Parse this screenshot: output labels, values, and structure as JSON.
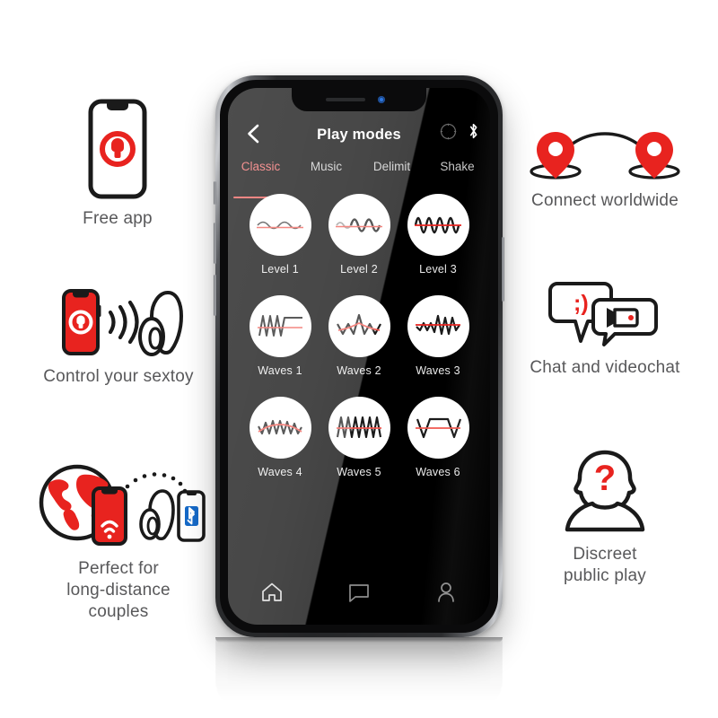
{
  "brand": {
    "red": "#e8231f",
    "dark": "#1a1a1a",
    "caption_gray": "#58585a",
    "accent_pink": "#ef5350"
  },
  "features_left": [
    {
      "id": "free-app",
      "icon": "phone-with-lock-icon",
      "caption": "Free app"
    },
    {
      "id": "control-sextoy",
      "icon": "phone-signal-toy-icon",
      "caption": "Control your sextoy"
    },
    {
      "id": "long-distance",
      "icon": "globe-phone-bluetooth-toy-icon",
      "caption": "Perfect for\nlong-distance\ncouples"
    }
  ],
  "features_right": [
    {
      "id": "connect-worldwide",
      "icon": "two-map-pins-arc-icon",
      "caption": "Connect worldwide"
    },
    {
      "id": "chat-videochat",
      "icon": "speech-bubbles-video-icon",
      "caption": "Chat and videochat",
      "emoticon": ";)"
    },
    {
      "id": "discreet-public-play",
      "icon": "anonymous-person-question-icon",
      "caption": "Discreet\npublic play",
      "question_mark": "?"
    }
  ],
  "phone": {
    "appbar": {
      "back_icon": "chevron-left-icon",
      "title": "Play modes",
      "icons": [
        "compass-icon",
        "bluetooth-icon"
      ]
    },
    "tabs": [
      {
        "label": "Classic",
        "active": true
      },
      {
        "label": "Music",
        "active": false
      },
      {
        "label": "Delimit",
        "active": false
      },
      {
        "label": "Shake",
        "active": false
      }
    ],
    "modes": [
      {
        "label": "Level 1",
        "wave": "sine-low"
      },
      {
        "label": "Level 2",
        "wave": "sine-mid"
      },
      {
        "label": "Level 3",
        "wave": "sine-high"
      },
      {
        "label": "Waves 1",
        "wave": "zigzag-then-flat"
      },
      {
        "label": "Waves 2",
        "wave": "peak-burst"
      },
      {
        "label": "Waves 3",
        "wave": "low-then-spikes"
      },
      {
        "label": "Waves 4",
        "wave": "dense-zigzag"
      },
      {
        "label": "Waves 5",
        "wave": "sawtooth-even"
      },
      {
        "label": "Waves 6",
        "wave": "trapezoid-plateau"
      }
    ],
    "navbar": [
      {
        "icon": "home-icon",
        "active": true
      },
      {
        "icon": "chat-bubble-icon",
        "active": false
      },
      {
        "icon": "person-icon",
        "active": false
      }
    ]
  }
}
